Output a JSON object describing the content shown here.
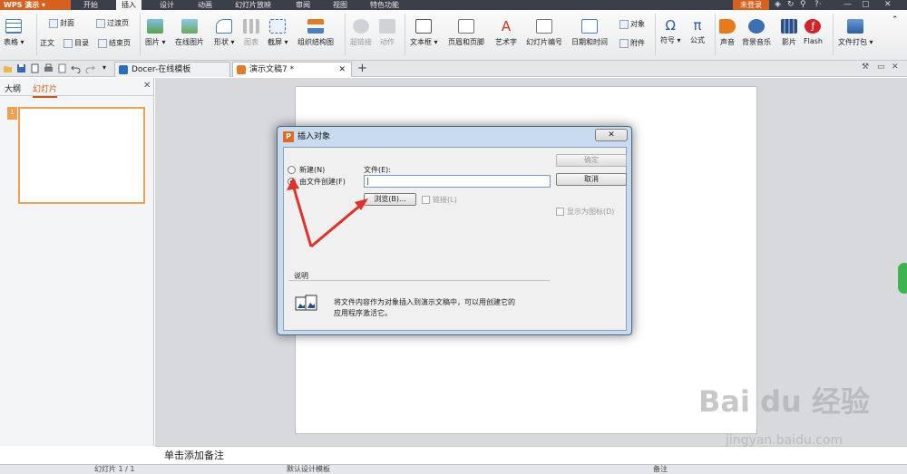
{
  "app": {
    "name": "WPS 演示"
  },
  "menu": {
    "tabs": [
      "开始",
      "插入",
      "设计",
      "动画",
      "幻灯片放映",
      "审阅",
      "视图",
      "特色功能"
    ],
    "active_tab": "插入",
    "login": "未登录"
  },
  "ribbon": {
    "table": "表格",
    "cover": "封面",
    "transition": "过渡页",
    "body": "正文",
    "toc": "目录",
    "end": "结束页",
    "picture": "图片",
    "online_picture": "在线图片",
    "shape": "形状",
    "chart": "图表",
    "screenshot": "截屏",
    "smartart": "组织结构图",
    "hyperlink": "超链接",
    "action": "动作",
    "textbox": "文本框",
    "header_footer": "页眉和页脚",
    "wordart": "艺术字",
    "slide_number": "幻灯片编号",
    "datetime": "日期和时间",
    "object": "对象",
    "attachment": "附件",
    "symbol": "符号",
    "formula": "公式",
    "sound": "声音",
    "bg_music": "背景音乐",
    "movie": "影片",
    "flash": "Flash",
    "package": "文件打包"
  },
  "doc_tabs": [
    {
      "label": "Docer-在线模板"
    },
    {
      "label": "演示文稿7 *"
    }
  ],
  "left_pane": {
    "tabs": [
      "大纲",
      "幻灯片"
    ],
    "active_tab": "幻灯片",
    "slide_number": "1"
  },
  "notes": {
    "placeholder": "单击添加备注"
  },
  "status": {
    "slide_info": "幻灯片 1 / 1",
    "theme": "默认设计模板",
    "notes_label": "备注"
  },
  "dialog": {
    "title": "插入对象",
    "create_new": "新建(N)",
    "create_from_file": "由文件创建(F)",
    "file_label": "文件(E):",
    "file_value": "|",
    "browse": "浏览(B)...",
    "link": "链接(L)",
    "ok": "确定",
    "cancel": "取消",
    "display_as_icon": "显示为图标(D)",
    "desc_heading": "说明",
    "desc_text_1": "将文件内容作为对象插入到演示文稿中，可以用创建它的",
    "desc_text_2": "应用程序激活它。"
  },
  "watermark": {
    "brand": "Bai du 经验",
    "url": "jingyan.baidu.com"
  }
}
